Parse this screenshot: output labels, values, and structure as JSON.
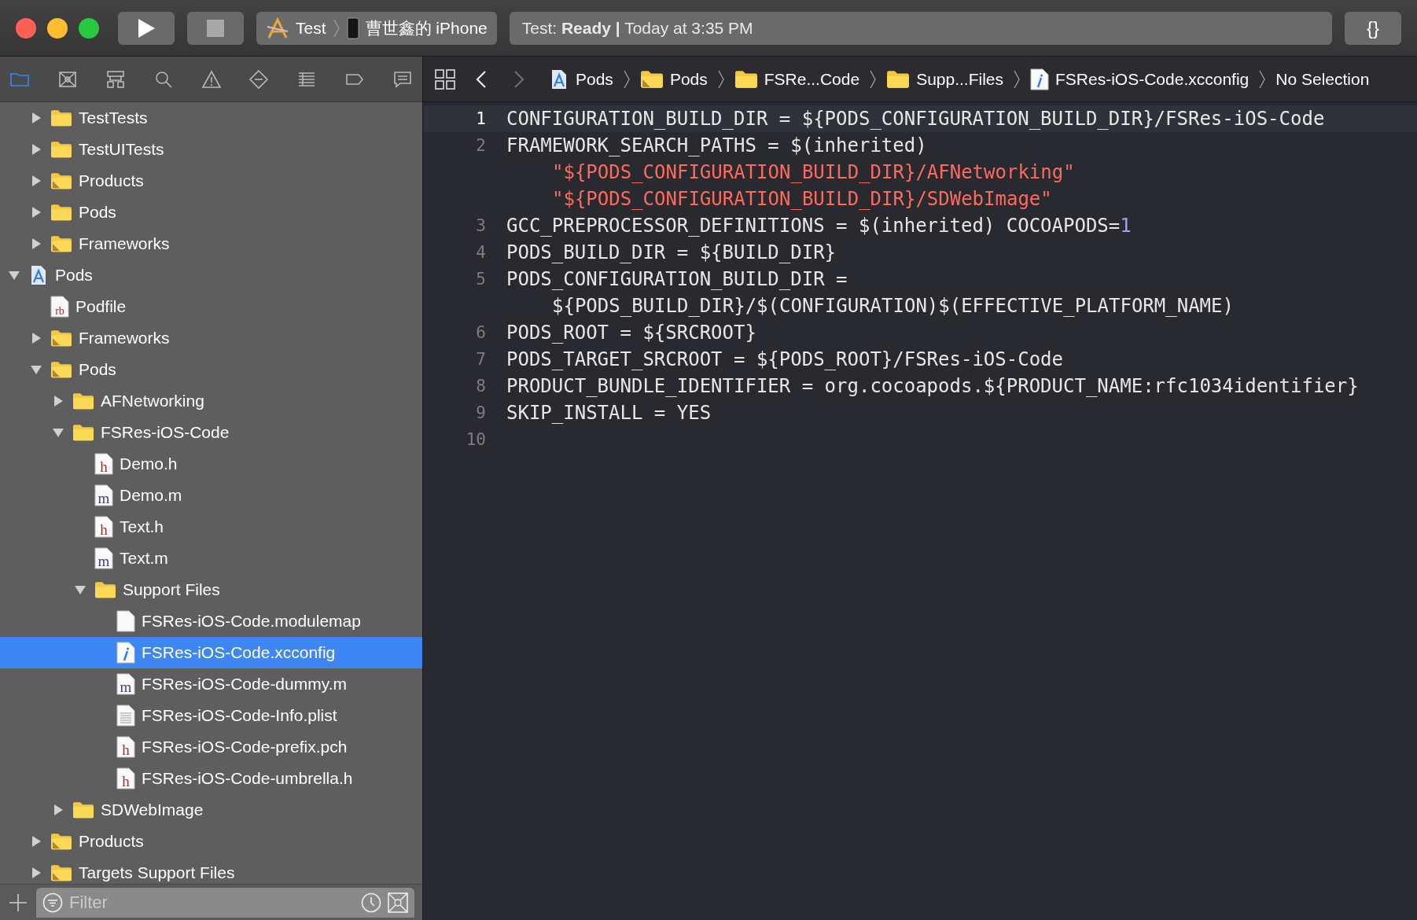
{
  "toolbar": {
    "scheme": {
      "target": "Test",
      "device": "曹世鑫的 iPhone"
    },
    "status": "Test: **Ready |** Today at 3:35 PM",
    "braces": "{}"
  },
  "navigator_tabs": [
    {
      "selected": true
    },
    {
      "selected": false
    },
    {
      "selected": false
    },
    {
      "selected": false
    },
    {
      "selected": false
    },
    {
      "selected": false
    },
    {
      "selected": false
    },
    {
      "selected": false
    },
    {
      "selected": false
    }
  ],
  "tree": [
    {
      "children": [
        {
          "label": "TestTests",
          "kind": "folder",
          "expanded": false,
          "selected": false
        },
        {
          "label": "TestUITests",
          "kind": "folder",
          "expanded": false,
          "selected": false
        },
        {
          "label": "Products",
          "kind": "group",
          "expanded": false,
          "selected": false
        },
        {
          "label": "Pods",
          "kind": "folder",
          "expanded": false,
          "selected": false
        },
        {
          "label": "Frameworks",
          "kind": "group",
          "expanded": false,
          "selected": false
        }
      ]
    },
    {
      "label": "Pods",
      "kind": "project",
      "expanded": true,
      "selected": false,
      "children": [
        {
          "label": "Podfile",
          "kind": "source",
          "badge": "rb",
          "selected": false
        },
        {
          "label": "Frameworks",
          "kind": "group",
          "expanded": false,
          "selected": false
        },
        {
          "label": "Pods",
          "kind": "group",
          "expanded": true,
          "selected": false,
          "children": [
            {
              "label": "AFNetworking",
              "kind": "folder",
              "expanded": false,
              "selected": false
            },
            {
              "label": "FSRes-iOS-Code",
              "kind": "folder",
              "expanded": true,
              "selected": false,
              "children": [
                {
                  "label": "Demo.h",
                  "kind": "source",
                  "badge": "h",
                  "selected": false
                },
                {
                  "label": "Demo.m",
                  "kind": "source",
                  "badge": "m",
                  "selected": false
                },
                {
                  "label": "Text.h",
                  "kind": "source",
                  "badge": "h",
                  "selected": false
                },
                {
                  "label": "Text.m",
                  "kind": "source",
                  "badge": "m",
                  "selected": false
                },
                {
                  "label": "Support Files",
                  "kind": "folder",
                  "expanded": true,
                  "selected": false,
                  "children": [
                    {
                      "label": "FSRes-iOS-Code.modulemap",
                      "kind": "blank",
                      "selected": false
                    },
                    {
                      "label": "FSRes-iOS-Code.xcconfig",
                      "kind": "config",
                      "selected": true
                    },
                    {
                      "label": "FSRes-iOS-Code-dummy.m",
                      "kind": "source",
                      "badge": "m",
                      "selected": false
                    },
                    {
                      "label": "FSRes-iOS-Code-Info.plist",
                      "kind": "plist",
                      "selected": false
                    },
                    {
                      "label": "FSRes-iOS-Code-prefix.pch",
                      "kind": "source",
                      "badge": "h",
                      "selected": false
                    },
                    {
                      "label": "FSRes-iOS-Code-umbrella.h",
                      "kind": "source",
                      "badge": "h",
                      "selected": false
                    }
                  ]
                }
              ]
            },
            {
              "label": "SDWebImage",
              "kind": "folder",
              "expanded": false,
              "selected": false
            }
          ]
        },
        {
          "label": "Products",
          "kind": "group",
          "expanded": false,
          "selected": false
        },
        {
          "label": "Targets Support Files",
          "kind": "group",
          "expanded": false,
          "selected": false
        }
      ]
    }
  ],
  "filter": {
    "placeholder": "Filter"
  },
  "breadcrumb": [
    {
      "label": "Pods",
      "kind": "project"
    },
    {
      "label": "Pods",
      "kind": "group"
    },
    {
      "label": "FSRe...Code",
      "kind": "folder"
    },
    {
      "label": "Supp...Files",
      "kind": "folder"
    },
    {
      "label": "FSRes-iOS-Code.xcconfig",
      "kind": "config"
    },
    {
      "label": "No Selection",
      "kind": "text"
    }
  ],
  "code": [
    {
      "number": "1",
      "current": true,
      "rows": [
        [
          {
            "kind": "plain",
            "text": "CONFIGURATION_BUILD_DIR = ${PODS_CONFIGURATION_BUILD_DIR}/FSRes-iOS-Code"
          }
        ]
      ]
    },
    {
      "number": "2",
      "current": false,
      "rows": [
        [
          {
            "kind": "plain",
            "text": "FRAMEWORK_SEARCH_PATHS = $(inherited)"
          }
        ],
        [
          {
            "kind": "string",
            "text": "\"${PODS_CONFIGURATION_BUILD_DIR}/AFNetworking\""
          }
        ],
        [
          {
            "kind": "string",
            "text": "\"${PODS_CONFIGURATION_BUILD_DIR}/SDWebImage\""
          }
        ]
      ]
    },
    {
      "number": "3",
      "current": false,
      "rows": [
        [
          {
            "kind": "plain",
            "text": "GCC_PREPROCESSOR_DEFINITIONS = $(inherited) COCOAPODS="
          },
          {
            "kind": "number",
            "text": "1"
          }
        ]
      ]
    },
    {
      "number": "4",
      "current": false,
      "rows": [
        [
          {
            "kind": "plain",
            "text": "PODS_BUILD_DIR = ${BUILD_DIR}"
          }
        ]
      ]
    },
    {
      "number": "5",
      "current": false,
      "rows": [
        [
          {
            "kind": "plain",
            "text": "PODS_CONFIGURATION_BUILD_DIR ="
          }
        ],
        [
          {
            "kind": "plain",
            "text": "${PODS_BUILD_DIR}/$(CONFIGURATION)$(EFFECTIVE_PLATFORM_NAME)"
          }
        ]
      ]
    },
    {
      "number": "6",
      "current": false,
      "rows": [
        [
          {
            "kind": "plain",
            "text": "PODS_ROOT = ${SRCROOT}"
          }
        ]
      ]
    },
    {
      "number": "7",
      "current": false,
      "rows": [
        [
          {
            "kind": "plain",
            "text": "PODS_TARGET_SRCROOT = ${PODS_ROOT}/FSRes-iOS-Code"
          }
        ]
      ]
    },
    {
      "number": "8",
      "current": false,
      "rows": [
        [
          {
            "kind": "plain",
            "text": "PRODUCT_BUNDLE_IDENTIFIER = org.cocoapods.${PRODUCT_NAME:rfc1034identifier}"
          }
        ]
      ]
    },
    {
      "number": "9",
      "current": false,
      "rows": [
        [
          {
            "kind": "plain",
            "text": "SKIP_INSTALL = YES"
          }
        ]
      ]
    },
    {
      "number": "10",
      "current": false
    }
  ]
}
